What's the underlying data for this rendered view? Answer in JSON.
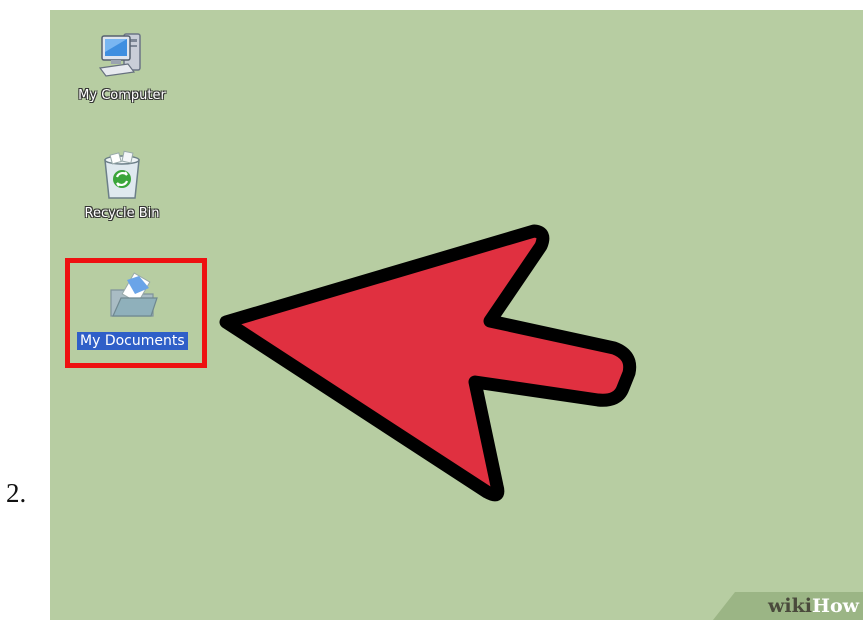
{
  "step": {
    "number": "2."
  },
  "desktop": {
    "background_color": "#b7cda2",
    "icons": [
      {
        "label": "My Computer",
        "icon": "my-computer-icon",
        "selected": false
      },
      {
        "label": "Recycle Bin",
        "icon": "recycle-bin-icon",
        "selected": false
      },
      {
        "label": "My Documents",
        "icon": "my-documents-icon",
        "selected": true
      }
    ]
  },
  "annotation": {
    "highlight_color": "#ee1111",
    "arrow_color": "#e03040",
    "arrow_outline_color": "#000000"
  },
  "watermark": {
    "wiki": "wiki",
    "how": "How"
  }
}
